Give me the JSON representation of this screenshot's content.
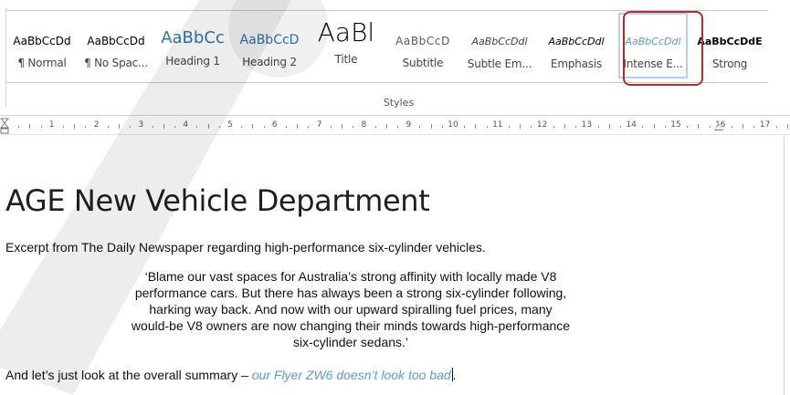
{
  "ribbon": {
    "group_label": "Styles",
    "styles": [
      {
        "preview": "AaBbCcDd",
        "label": "¶ Normal",
        "cls": "p-normal"
      },
      {
        "preview": "AaBbCcDd",
        "label": "¶ No Spac...",
        "cls": "p-nospacing"
      },
      {
        "preview": "AaBbCc",
        "label": "Heading 1",
        "cls": "p-h1"
      },
      {
        "preview": "AaBbCcD",
        "label": "Heading 2",
        "cls": "p-h2"
      },
      {
        "preview": "AaBl",
        "label": "Title",
        "cls": "p-title"
      },
      {
        "preview": "AaBbCcD",
        "label": "Subtitle",
        "cls": "p-subtitle"
      },
      {
        "preview": "AaBbCcDdl",
        "label": "Subtle Em...",
        "cls": "p-subtle"
      },
      {
        "preview": "AaBbCcDdl",
        "label": "Emphasis",
        "cls": "p-emph"
      },
      {
        "preview": "AaBbCcDdl",
        "label": "Intense E...",
        "cls": "p-intense"
      },
      {
        "preview": "AaBbCcDdE",
        "label": "Strong",
        "cls": "p-strong"
      }
    ],
    "selected_style": "Intense E..."
  },
  "ruler": {
    "numbers": [
      "1",
      "2",
      "3",
      "4",
      "5",
      "6",
      "7",
      "8",
      "9",
      "10",
      "11",
      "12",
      "13",
      "14",
      "15",
      "16",
      "17"
    ]
  },
  "document": {
    "title": "AGE New Vehicle Department",
    "intro": "Excerpt from The Daily Newspaper regarding high-performance six-cylinder vehicles.",
    "quote_lines": [
      "‘Blame our vast spaces for Australia’s strong affinity with locally made V8",
      "performance cars. But there has always been a strong six-cylinder following,",
      "harking way back. And now with our upward spiralling fuel prices, many",
      "would-be V8 owners are now changing their minds towards high-performance",
      "six-cylinder sedans.’"
    ],
    "summary_text": "And let’s just look at the overall summary – ",
    "summary_emphasis": "our Flyer ZW6 doesn’t look too bad",
    "summary_end": "."
  },
  "colors": {
    "heading_blue": "#2e74b5",
    "intense_blue": "#5b9bd5",
    "highlight_red": "#b52a2a"
  }
}
